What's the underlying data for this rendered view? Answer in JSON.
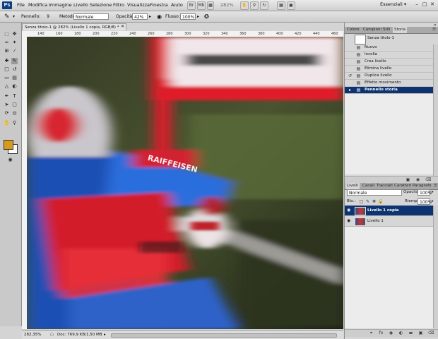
{
  "app": {
    "logo": "Ps"
  },
  "menu": [
    "File",
    "Modifica",
    "Immagine",
    "Livello",
    "Selezione",
    "Filtro",
    "Visualizza",
    "Finestra",
    "Aiuto"
  ],
  "menubar": {
    "zoom": "282%",
    "workspace": "Essenziali ▾",
    "win_controls": [
      "–",
      "□",
      "✕"
    ]
  },
  "options": {
    "brush_label": "Pennello:",
    "brush_size": "9",
    "mode_label": "Metodo:",
    "mode_value": "Normale",
    "opacity_label": "Opacità:",
    "opacity_value": "42%",
    "flow_label": "Flusso:",
    "flow_value": "100%"
  },
  "document": {
    "tab": "Senza titolo-1 @ 282% (Livello 1 copia, RGB/8) *",
    "ruler_ticks": [
      "140",
      "160",
      "180",
      "200",
      "220",
      "240",
      "260",
      "280",
      "300",
      "320",
      "340",
      "360",
      "380",
      "400",
      "420",
      "440",
      "460"
    ],
    "status_zoom": "282,35%",
    "status_doc": "Doc: 769,9 KB/1,50 MB",
    "canvas_text": {
      "bib_text": "RAIFFEISEN"
    }
  },
  "history_panel": {
    "tabs": [
      "Colore",
      "Campioni",
      "Stili",
      "Storia"
    ],
    "snapshot": "Senza titolo-1",
    "items": [
      "Nuovo",
      "Incolla",
      "Crea livello",
      "Elimina livello",
      "Duplica livello",
      "Effetto movimento",
      "Pennello storia"
    ],
    "selected_index": 6
  },
  "layers_panel": {
    "tabs": [
      "Livelli",
      "Canali",
      "Tracciati",
      "Caratteri",
      "Paragrafo"
    ],
    "blend_mode": "Normale",
    "opacity_label": "Opacità:",
    "opacity_value": "100%",
    "lock_label": "Blo.:",
    "fill_label": "Riemp.:",
    "fill_value": "100%",
    "layers": [
      {
        "name": "Livello 1 copia",
        "selected": true
      },
      {
        "name": "Livello 1",
        "selected": false
      }
    ],
    "bottom_icons": [
      "link-icon",
      "fx-icon",
      "mask-icon",
      "adjustment-icon",
      "folder-icon",
      "new-layer-icon",
      "trash-icon"
    ]
  },
  "colors": {
    "accent": "#0d3470",
    "foreground": "#d99a1c",
    "background": "#ffffff"
  }
}
